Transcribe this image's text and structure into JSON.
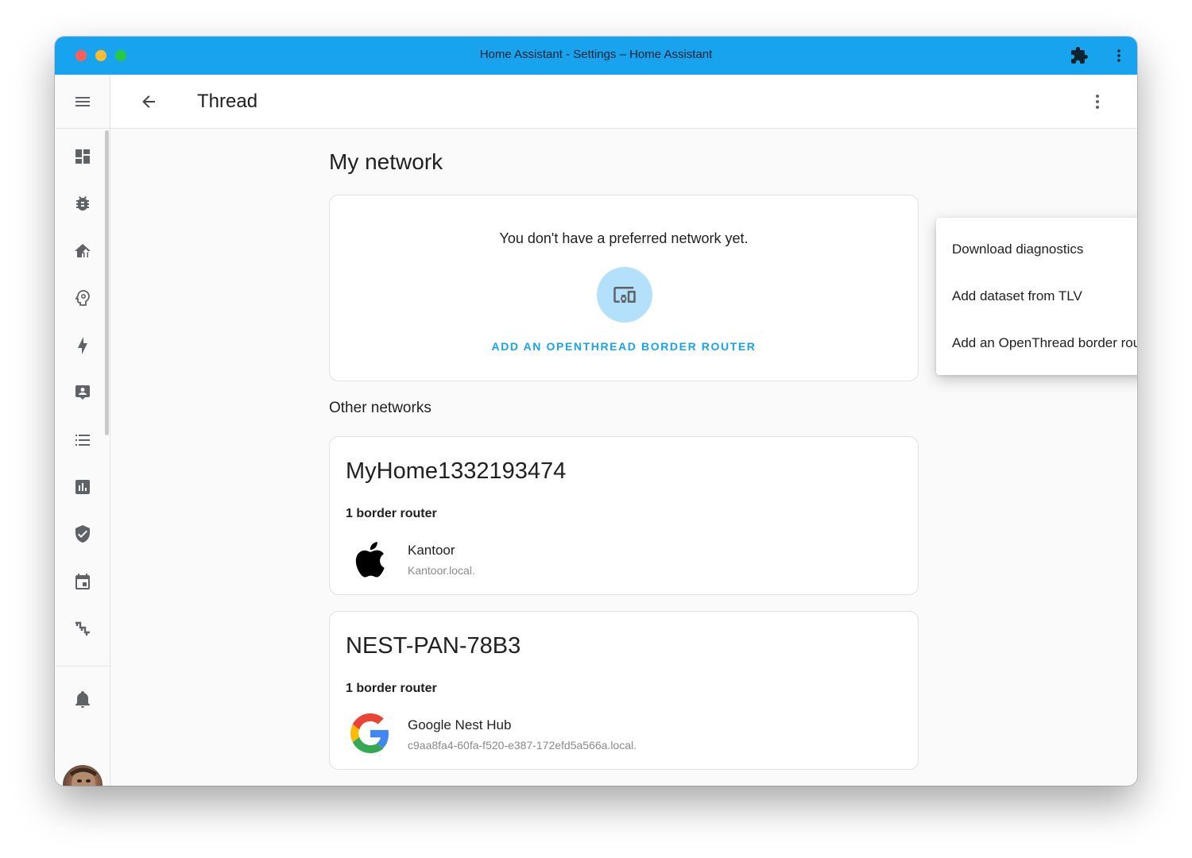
{
  "window": {
    "title": "Home Assistant - Settings – Home Assistant"
  },
  "header": {
    "title": "Thread"
  },
  "sidebar": {
    "items": [
      {
        "icon": "dashboard-icon"
      },
      {
        "icon": "bug-icon"
      },
      {
        "icon": "home-upload-icon"
      },
      {
        "icon": "head-lightbulb-icon"
      },
      {
        "icon": "lightning-bolt-icon"
      },
      {
        "icon": "account-box-icon"
      },
      {
        "icon": "format-list-icon"
      },
      {
        "icon": "chart-box-icon"
      },
      {
        "icon": "shield-check-icon"
      },
      {
        "icon": "calendar-icon"
      },
      {
        "icon": "stairs-icon"
      },
      {
        "icon": "bell-icon"
      }
    ]
  },
  "my_network": {
    "title": "My network",
    "message": "You don't have a preferred network yet.",
    "action_label": "ADD AN OPENTHREAD BORDER ROUTER"
  },
  "other_networks": {
    "title": "Other networks",
    "networks": [
      {
        "name": "MyHome1332193474",
        "router_count": "1 border router",
        "router": {
          "name": "Kantoor",
          "host": "Kantoor.local.",
          "logo": "apple-logo"
        }
      },
      {
        "name": "NEST-PAN-78B3",
        "router_count": "1 border router",
        "router": {
          "name": "Google Nest Hub",
          "host": "c9aa8fa4-60fa-f520-e387-172efd5a566a.local.",
          "logo": "google-logo"
        }
      }
    ]
  },
  "overflow_menu": {
    "items": [
      {
        "label": "Download diagnostics"
      },
      {
        "label": "Add dataset from TLV"
      },
      {
        "label": "Add an OpenThread border router"
      }
    ]
  },
  "colors": {
    "titlebar": "#18a3ef",
    "accent": "#18a3ef",
    "accent_light": "#b3e1fb",
    "icon": "#5f6368"
  }
}
